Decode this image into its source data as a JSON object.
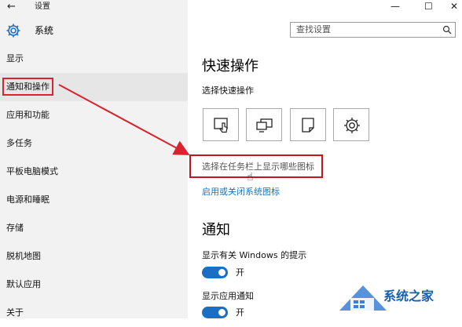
{
  "window": {
    "title": "设置",
    "back_glyph": "←",
    "minimize_glyph": "—",
    "maximize_glyph": "☐",
    "close_glyph": "✕"
  },
  "header": {
    "title": "系统"
  },
  "search": {
    "placeholder": "查找设置",
    "icon": "search-icon"
  },
  "nav": {
    "items": [
      {
        "label": "显示"
      },
      {
        "label": "通知和操作",
        "active": true
      },
      {
        "label": "应用和功能"
      },
      {
        "label": "多任务"
      },
      {
        "label": "平板电脑模式"
      },
      {
        "label": "电源和睡眠"
      },
      {
        "label": "存储"
      },
      {
        "label": "脱机地图"
      },
      {
        "label": "默认应用"
      },
      {
        "label": "关于"
      }
    ]
  },
  "main": {
    "quick_actions": {
      "heading": "快速操作",
      "subheading": "选择快速操作",
      "buttons": [
        {
          "icon": "tablet-touch-icon"
        },
        {
          "icon": "project-display-icon"
        },
        {
          "icon": "note-icon"
        },
        {
          "icon": "gear-icon"
        }
      ],
      "taskbar_link": "选择在任务栏上显示哪些图标",
      "system_icons_link": "启用或关闭系统图标"
    },
    "notifications": {
      "heading": "通知",
      "tips_label": "显示有关 Windows 的提示",
      "tips_state": "开",
      "apps_label": "显示应用通知",
      "apps_state": "开"
    }
  },
  "colors": {
    "accent": "#1a6fc4",
    "highlight": "#d9232e",
    "link": "#1a73b8"
  },
  "watermark": {
    "text": "系统之家"
  }
}
